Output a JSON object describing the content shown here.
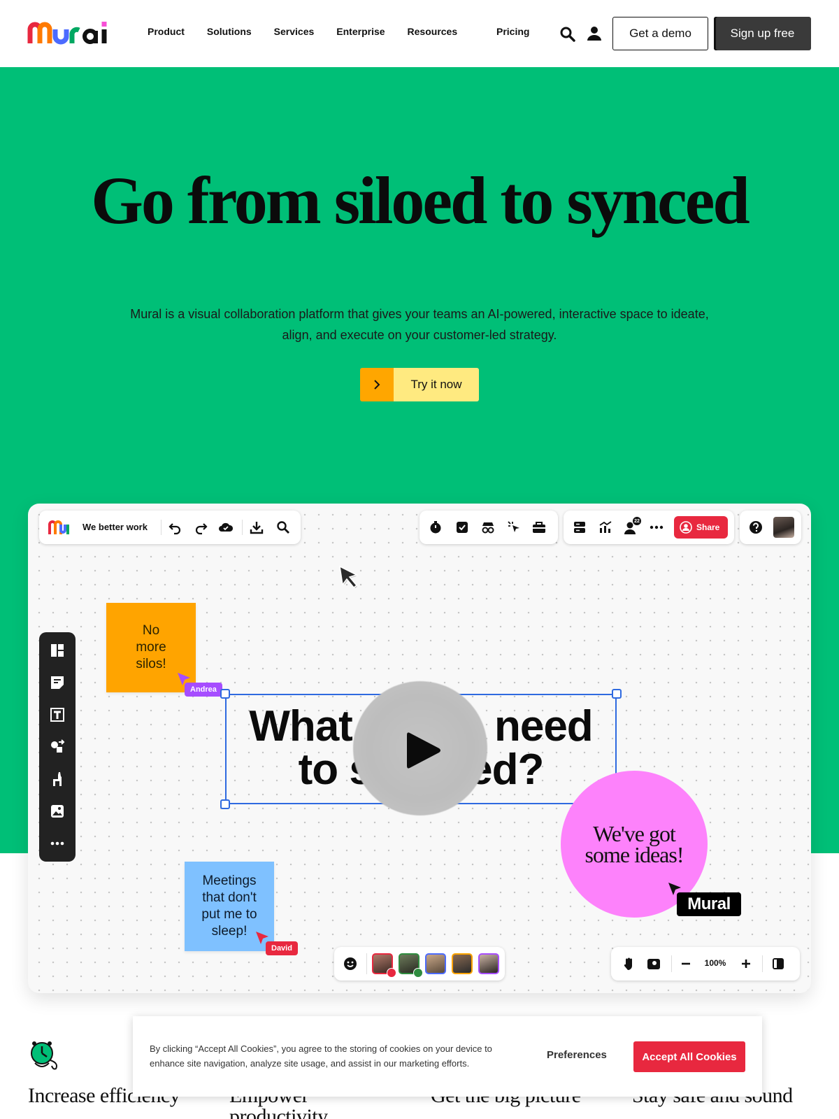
{
  "nav": {
    "logo": "Mural",
    "links": [
      "Product",
      "Solutions",
      "Services",
      "Enterprise",
      "Resources"
    ],
    "pricing": "Pricing",
    "demo_label": "Get a demo",
    "signup_label": "Sign up free",
    "icons": [
      "search-icon",
      "user-icon"
    ]
  },
  "hero": {
    "title": "Go from siloed to synced",
    "subtitle": "Mural is a visual collaboration platform that gives your teams an AI-powered, interactive space to ideate, align, and execute on your customer-led strategy.",
    "cta_label": "Try it now",
    "background_color": "#00bf77"
  },
  "board": {
    "title": "We better work",
    "share_label": "Share",
    "participant_count": "22",
    "sticky_orange": "No more silos!",
    "sticky_blue": "Meetings that don't put me to sleep!",
    "cursor_andrea": "Andrea",
    "cursor_david": "David",
    "big_text": "What do we need to succeed?",
    "circle_text": "We've got some ideas!",
    "mural_tag": "Mural",
    "zoom": "100%"
  },
  "features": [
    "Increase efficiency",
    "Empower productivity",
    "Get the big picture",
    "Stay safe and sound"
  ],
  "cookie": {
    "text": "By clicking “Accept All Cookies”, you agree to the storing of cookies on your device to enhance site navigation, analyze site usage, and assist in our marketing efforts.",
    "preferences_label": "Preferences",
    "accept_label": "Accept All Cookies"
  },
  "colors": {
    "accent_red": "#e8283f",
    "cta_yellow": "#ffea80",
    "cta_orange": "#ffa600",
    "sticky_orange": "#ffa400",
    "sticky_blue": "#7fc1ff",
    "pink": "#fd82fb"
  }
}
